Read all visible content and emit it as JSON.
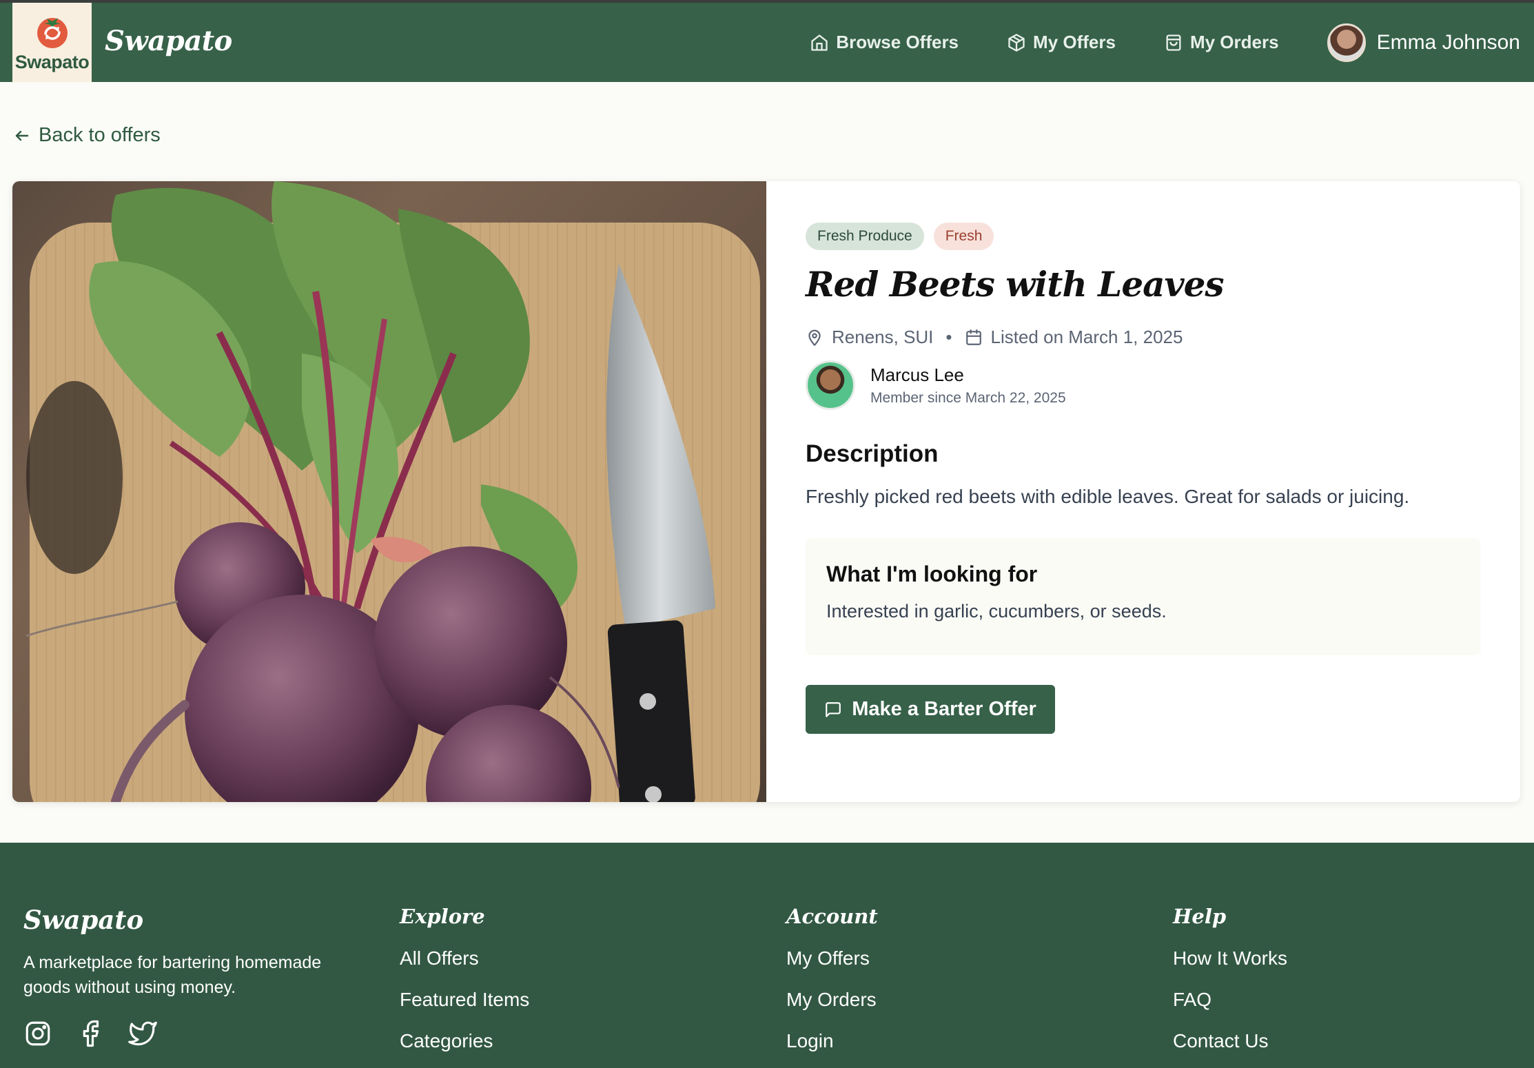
{
  "app": {
    "logo_text": "Swapato",
    "brand_script": "Swapato"
  },
  "nav": {
    "browse": "Browse Offers",
    "my_offers": "My Offers",
    "my_orders": "My Orders",
    "user_name": "Emma Johnson"
  },
  "back_link": "Back to offers",
  "listing": {
    "tags": [
      "Fresh Produce",
      "Fresh"
    ],
    "title": "Red Beets with Leaves",
    "location": "Renens, SUI",
    "separator": "•",
    "listed": "Listed on March 1, 2025",
    "seller": {
      "name": "Marcus Lee",
      "since": "Member since March 22, 2025"
    },
    "description_heading": "Description",
    "description": "Freshly picked red beets with edible leaves. Great for salads or juicing.",
    "looking_for_heading": "What I'm looking for",
    "looking_for": "Interested in garlic, cucumbers, or seeds.",
    "cta": "Make a Barter Offer"
  },
  "footer": {
    "brand": "Swapato",
    "tagline": "A marketplace for bartering homemade goods without using money.",
    "socials": [
      "instagram-icon",
      "facebook-icon",
      "twitter-icon"
    ],
    "explore": {
      "heading": "Explore",
      "links": [
        "All Offers",
        "Featured Items",
        "Categories"
      ]
    },
    "account": {
      "heading": "Account",
      "links": [
        "My Offers",
        "My Orders",
        "Login"
      ]
    },
    "help": {
      "heading": "Help",
      "links": [
        "How It Works",
        "FAQ",
        "Contact Us"
      ]
    }
  },
  "colors": {
    "brand": "#376149",
    "footer": "#325843",
    "cream": "#fbfbf7"
  }
}
